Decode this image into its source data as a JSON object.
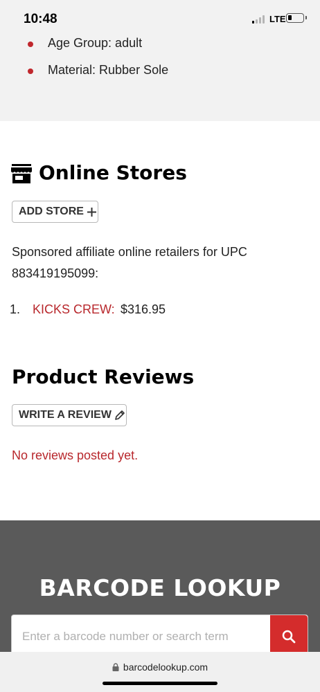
{
  "status_bar": {
    "time": "10:48",
    "network": "LTE"
  },
  "attributes": [
    {
      "text": "Age Group: adult"
    },
    {
      "text": "Material: Rubber Sole"
    }
  ],
  "online_stores": {
    "title": "Online Stores",
    "icon": "store-icon",
    "add_store_label": "ADD STORE",
    "add_icon": "plus-icon",
    "sponsored_text": "Sponsored affiliate online retailers for UPC 883419195099:",
    "retailers": [
      {
        "number": "1.",
        "name": "KICKS CREW:",
        "price": "$316.95"
      }
    ]
  },
  "reviews": {
    "title": "Product Reviews",
    "write_review_label": "WRITE A REVIEW",
    "write_icon": "pencil-icon",
    "empty_message": "No reviews posted yet."
  },
  "footer": {
    "title": "BARCODE LOOKUP",
    "search_placeholder": "Enter a barcode number or search term",
    "search_icon": "search-icon"
  },
  "browser": {
    "url": "barcodelookup.com"
  },
  "colors": {
    "accent_red": "#b8272c",
    "search_button": "#d42c2c",
    "footer_bg": "#5a5a5a",
    "section_gray": "#f2f2f2"
  }
}
